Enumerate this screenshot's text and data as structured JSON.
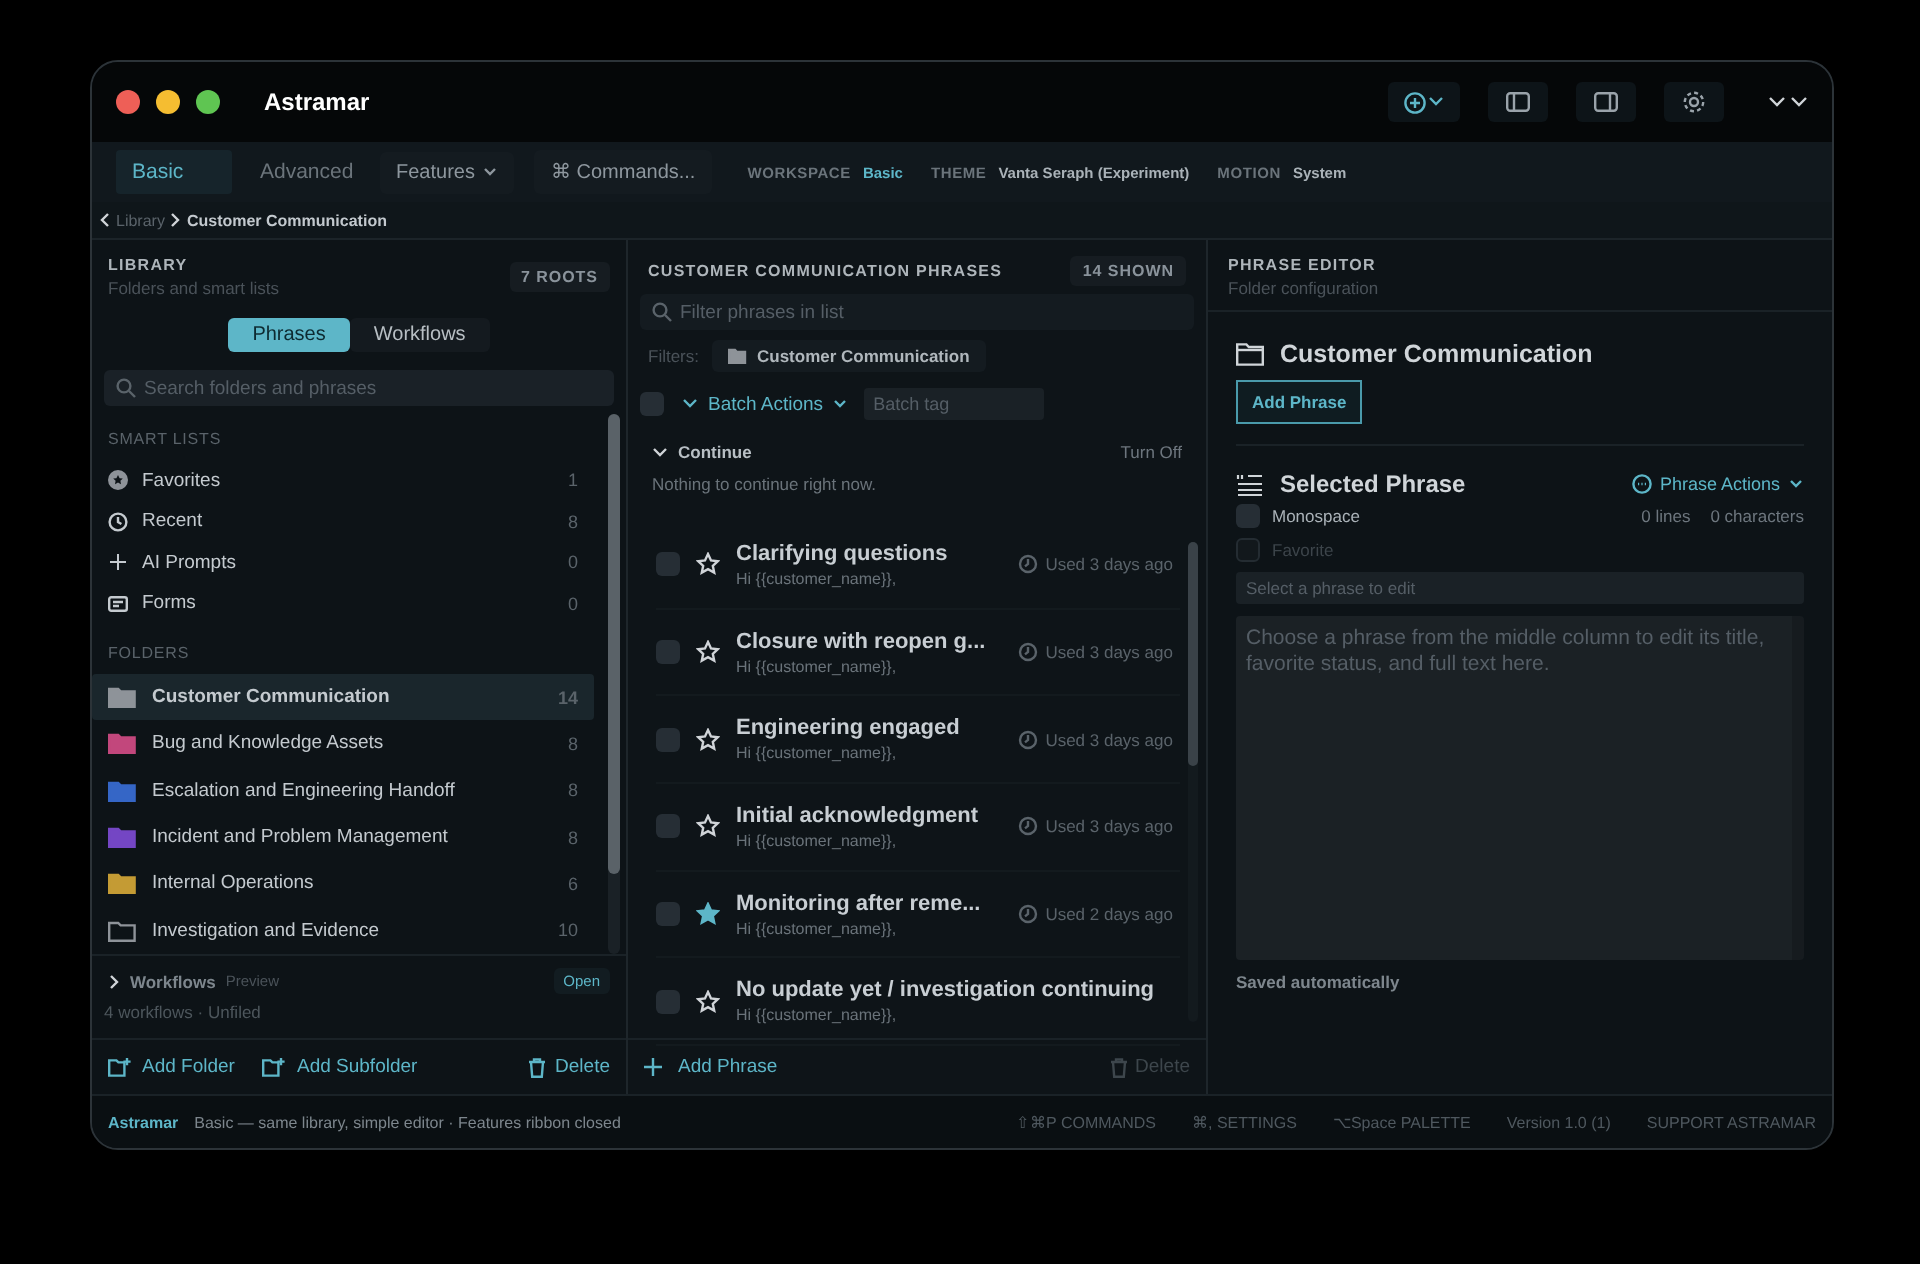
{
  "window": {
    "title": "Astramar"
  },
  "toolbar": {
    "modes": [
      {
        "label": "Basic",
        "selected": true
      },
      {
        "label": "Advanced",
        "selected": false
      }
    ],
    "features": "Features",
    "commands": "⌘ Commands...",
    "meta": [
      {
        "key": "WORKSPACE",
        "value": "Basic",
        "accent": true
      },
      {
        "key": "THEME",
        "value": "Vanta Seraph (Experiment)",
        "accent": false
      },
      {
        "key": "MOTION",
        "value": "System",
        "accent": false
      }
    ]
  },
  "breadcrumb": [
    "Library",
    "Customer Communication"
  ],
  "library": {
    "title": "LIBRARY",
    "subtitle": "Folders and smart lists",
    "badge": "7 ROOTS",
    "segments": [
      {
        "label": "Phrases",
        "selected": true
      },
      {
        "label": "Workflows",
        "selected": false
      }
    ],
    "search": {
      "placeholder": "Search folders and phrases"
    },
    "smart_lists_label": "SMART LISTS",
    "smart_lists": [
      {
        "kind": "favorites",
        "label": "Favorites",
        "count": "1"
      },
      {
        "kind": "recent",
        "label": "Recent",
        "count": "8"
      },
      {
        "kind": "ai",
        "label": "AI Prompts",
        "count": "0"
      },
      {
        "kind": "forms",
        "label": "Forms",
        "count": "0"
      }
    ],
    "folders_label": "FOLDERS",
    "folders": [
      {
        "label": "Customer Communication",
        "count": "14",
        "color": "#8e9399",
        "filled": true,
        "selected": true
      },
      {
        "label": "Bug and Knowledge Assets",
        "count": "8",
        "color": "#c2477c",
        "filled": true,
        "selected": false
      },
      {
        "label": "Escalation and Engineering Handoff",
        "count": "8",
        "color": "#3566c6",
        "filled": true,
        "selected": false
      },
      {
        "label": "Incident and Problem Management",
        "count": "8",
        "color": "#7446c4",
        "filled": true,
        "selected": false
      },
      {
        "label": "Internal Operations",
        "count": "6",
        "color": "#c49b34",
        "filled": true,
        "selected": false
      },
      {
        "label": "Investigation and Evidence",
        "count": "10",
        "color": "#8e9399",
        "filled": false,
        "selected": false
      }
    ],
    "workflows": {
      "label": "Workflows",
      "tag": "Preview",
      "action": "Open",
      "expanded": false,
      "summary": "4 workflows · Unfiled"
    },
    "footer": [
      {
        "kind": "add-folder",
        "label": "Add Folder"
      },
      {
        "kind": "add-subfolder",
        "label": "Add Subfolder"
      },
      {
        "kind": "delete",
        "label": "Delete"
      }
    ]
  },
  "phrases": {
    "title": "CUSTOMER COMMUNICATION PHRASES",
    "badge": "14 SHOWN",
    "filter": {
      "placeholder": "Filter phrases in list"
    },
    "filters_label": "Filters:",
    "filter_chip": "Customer Communication",
    "select_all": {
      "checked": false
    },
    "batch_actions": "Batch Actions",
    "batch_tag": {
      "placeholder": "Batch tag"
    },
    "continue": {
      "label": "Continue",
      "expanded": true,
      "action": "Turn Off",
      "empty": "Nothing to continue right now."
    },
    "rows": [
      {
        "title": "Clarifying questions",
        "preview": "Hi {{customer_name}},",
        "used": "Used 3 days ago",
        "favorite": false,
        "checked": false
      },
      {
        "title": "Closure with reopen g...",
        "preview": "Hi {{customer_name}},",
        "used": "Used 3 days ago",
        "favorite": false,
        "checked": false
      },
      {
        "title": "Engineering engaged",
        "preview": "Hi {{customer_name}},",
        "used": "Used 3 days ago",
        "favorite": false,
        "checked": false
      },
      {
        "title": "Initial acknowledgment",
        "preview": "Hi {{customer_name}},",
        "used": "Used 3 days ago",
        "favorite": false,
        "checked": false
      },
      {
        "title": "Monitoring after reme...",
        "preview": "Hi {{customer_name}},",
        "used": "Used 2 days ago",
        "favorite": true,
        "checked": false
      },
      {
        "title": "No update yet / investigation continuing",
        "preview": "Hi {{customer_name}},",
        "favorite": false,
        "checked": false
      }
    ],
    "add": "Add Phrase",
    "delete": {
      "label": "Delete",
      "disabled": true
    }
  },
  "editor": {
    "title": "PHRASE EDITOR",
    "subtitle": "Folder configuration",
    "folder": "Customer Communication",
    "add": "Add Phrase",
    "section": "Selected Phrase",
    "actions": "Phrase Actions",
    "options": [
      {
        "label": "Monospace",
        "checked": false,
        "disabled": false
      },
      {
        "label": "Favorite",
        "checked": false,
        "disabled": true
      }
    ],
    "lines": "0 lines",
    "characters": "0 characters",
    "title_field": {
      "placeholder": "Select a phrase to edit"
    },
    "body_field": {
      "placeholder": "Choose a phrase from the middle column to edit its title, favorite status, and full text here."
    },
    "saved": "Saved automatically"
  },
  "status_bar": {
    "app": "Astramar",
    "mode": "Basic — same library, simple editor · Features ribbon closed",
    "items": [
      "⇧⌘P COMMANDS",
      "⌘, SETTINGS",
      "⌥Space PALETTE",
      "Version 1.0 (1)",
      "SUPPORT ASTRAMAR"
    ]
  }
}
